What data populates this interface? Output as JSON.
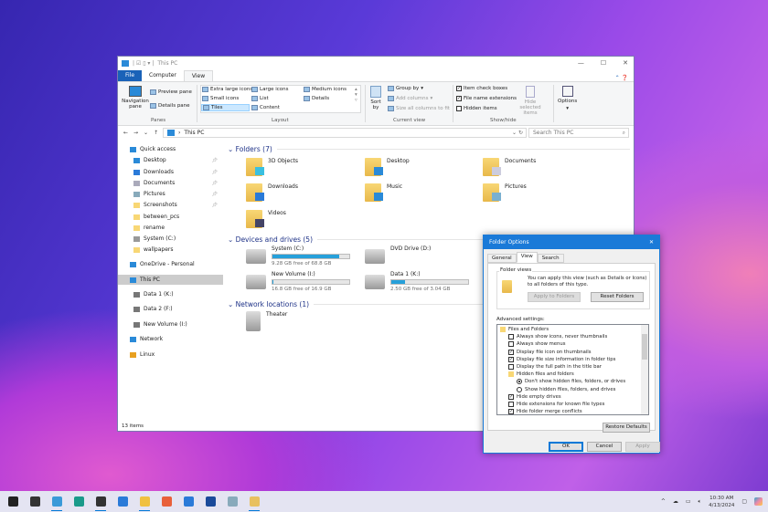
{
  "explorer": {
    "title": "This PC",
    "tabs": [
      "File",
      "Computer",
      "View"
    ],
    "ribbon": {
      "panes": {
        "navigation_pane": "Navigation pane",
        "preview_pane": "Preview pane",
        "details_pane": "Details pane",
        "group": "Panes"
      },
      "layout": {
        "options": [
          "Extra large icons",
          "Large icons",
          "Medium icons",
          "Small icons",
          "List",
          "Details",
          "Tiles",
          "Content"
        ],
        "selected": "Tiles",
        "group": "Layout"
      },
      "current_view": {
        "sort_by": "Sort by",
        "group_by": "Group by",
        "add_columns": "Add columns",
        "size_columns": "Size all columns to fit",
        "group": "Current view"
      },
      "show_hide": {
        "item_check_boxes": "Item check boxes",
        "item_check_boxes_checked": true,
        "file_name_extensions": "File name extensions",
        "file_name_extensions_checked": true,
        "hidden_items": "Hidden items",
        "hidden_items_checked": false,
        "hide_selected": "Hide selected items",
        "group": "Show/hide"
      },
      "options": "Options"
    },
    "address": {
      "path": "This PC",
      "search_placeholder": "Search This PC"
    },
    "sidebar": [
      {
        "label": "Quick access",
        "icon": "star-icon",
        "color": "#2a8ad8"
      },
      {
        "label": "Desktop",
        "icon": "desktop-icon",
        "color": "#2a8ad8",
        "pinned": true
      },
      {
        "label": "Downloads",
        "icon": "download-icon",
        "color": "#2a7ad8",
        "pinned": true
      },
      {
        "label": "Documents",
        "icon": "documents-icon",
        "color": "#aab",
        "pinned": true
      },
      {
        "label": "Pictures",
        "icon": "pictures-icon",
        "color": "#8ab",
        "pinned": true
      },
      {
        "label": "Screenshots",
        "icon": "folder-icon",
        "color": "#f8d775",
        "pinned": true
      },
      {
        "label": "between_pcs",
        "icon": "folder-icon",
        "color": "#f8d775"
      },
      {
        "label": "rename",
        "icon": "folder-icon",
        "color": "#f8d775"
      },
      {
        "label": "System (C:)",
        "icon": "drive-icon",
        "color": "#999"
      },
      {
        "label": "wallpapers",
        "icon": "folder-icon",
        "color": "#f8d775"
      },
      {
        "label": "OneDrive - Personal",
        "icon": "cloud-icon",
        "color": "#2a8ad8"
      },
      {
        "label": "This PC",
        "icon": "computer-icon",
        "color": "#2a8ad8",
        "selected": true
      },
      {
        "label": "Data 1 (K:)",
        "icon": "drive-icon",
        "color": "#777"
      },
      {
        "label": "Data 2 (F:)",
        "icon": "drive-icon",
        "color": "#777"
      },
      {
        "label": "New Volume (I:)",
        "icon": "drive-icon",
        "color": "#777"
      },
      {
        "label": "Network",
        "icon": "network-icon",
        "color": "#2a8ad8"
      },
      {
        "label": "Linux",
        "icon": "linux-icon",
        "color": "#e8a020"
      }
    ],
    "sections": {
      "folders": "Folders (7)",
      "devices": "Devices and drives (5)",
      "network": "Network locations (1)"
    },
    "folders": [
      {
        "name": "3D Objects",
        "accent": "#3ac0e0"
      },
      {
        "name": "Desktop",
        "accent": "#2a8ad8"
      },
      {
        "name": "Documents",
        "accent": "#ccd"
      },
      {
        "name": "Downloads",
        "accent": "#2a7ad8"
      },
      {
        "name": "Music",
        "accent": "#2a8ad8"
      },
      {
        "name": "Pictures",
        "accent": "#7ab0d0"
      },
      {
        "name": "Videos",
        "accent": "#446"
      }
    ],
    "drives": [
      {
        "name": "System (C:)",
        "free": "9.28 GB free of 68.8 GB",
        "used_fraction": 0.865
      },
      {
        "name": "DVD Drive (D:)"
      },
      {
        "name": "New Volume (I:)",
        "free": "16.8 GB free of 16.9 GB",
        "used_fraction": 0.006
      },
      {
        "name": "Data 1 (K:)",
        "free": "2.50 GB free of 3.04 GB",
        "used_fraction": 0.178
      }
    ],
    "network_locations": [
      {
        "name": "Theater"
      }
    ],
    "status": "13 items"
  },
  "dialog": {
    "title": "Folder Options",
    "tabs": [
      "General",
      "View",
      "Search"
    ],
    "active_tab": "View",
    "folder_views_label": "Folder views",
    "folder_views_text": "You can apply this view (such as Details or Icons) to all folders of this type.",
    "apply_to_folders": "Apply to Folders",
    "reset_folders": "Reset Folders",
    "advanced_label": "Advanced settings:",
    "settings": [
      {
        "type": "folder",
        "label": "Files and Folders",
        "level": 0
      },
      {
        "type": "check",
        "label": "Always show icons, never thumbnails",
        "checked": false,
        "level": 1
      },
      {
        "type": "check",
        "label": "Always show menus",
        "checked": false,
        "level": 1
      },
      {
        "type": "check",
        "label": "Display file icon on thumbnails",
        "checked": true,
        "level": 1
      },
      {
        "type": "check",
        "label": "Display file size information in folder tips",
        "checked": true,
        "level": 1
      },
      {
        "type": "check",
        "label": "Display the full path in the title bar",
        "checked": false,
        "level": 1
      },
      {
        "type": "folder",
        "label": "Hidden files and folders",
        "level": 1
      },
      {
        "type": "radio",
        "label": "Don't show hidden files, folders, or drives",
        "checked": true,
        "level": 2
      },
      {
        "type": "radio",
        "label": "Show hidden files, folders, and drives",
        "checked": false,
        "level": 2
      },
      {
        "type": "check",
        "label": "Hide empty drives",
        "checked": true,
        "level": 1
      },
      {
        "type": "check",
        "label": "Hide extensions for known file types",
        "checked": false,
        "level": 1
      },
      {
        "type": "check",
        "label": "Hide folder merge conflicts",
        "checked": true,
        "level": 1
      }
    ],
    "restore_defaults": "Restore Defaults",
    "ok": "OK",
    "cancel": "Cancel",
    "apply": "Apply"
  },
  "taskbar": {
    "apps": [
      {
        "name": "start",
        "color": "#222"
      },
      {
        "name": "settings",
        "color": "#333"
      },
      {
        "name": "control-panel",
        "color": "#3a9ad8",
        "running": true
      },
      {
        "name": "edge",
        "color": "#1a9a8a"
      },
      {
        "name": "terminal",
        "color": "#333",
        "running": true
      },
      {
        "name": "vscode",
        "color": "#2a7ad8"
      },
      {
        "name": "file-explorer",
        "color": "#f0c040",
        "running": true
      },
      {
        "name": "firefox",
        "color": "#e8603a"
      },
      {
        "name": "photos",
        "color": "#2a7ad8"
      },
      {
        "name": "store",
        "color": "#1a4a9a"
      },
      {
        "name": "notepad",
        "color": "#8ab"
      },
      {
        "name": "folder-options",
        "color": "#e8c060",
        "running": true
      }
    ],
    "time": "10:30 AM",
    "date": "4/13/2024"
  }
}
